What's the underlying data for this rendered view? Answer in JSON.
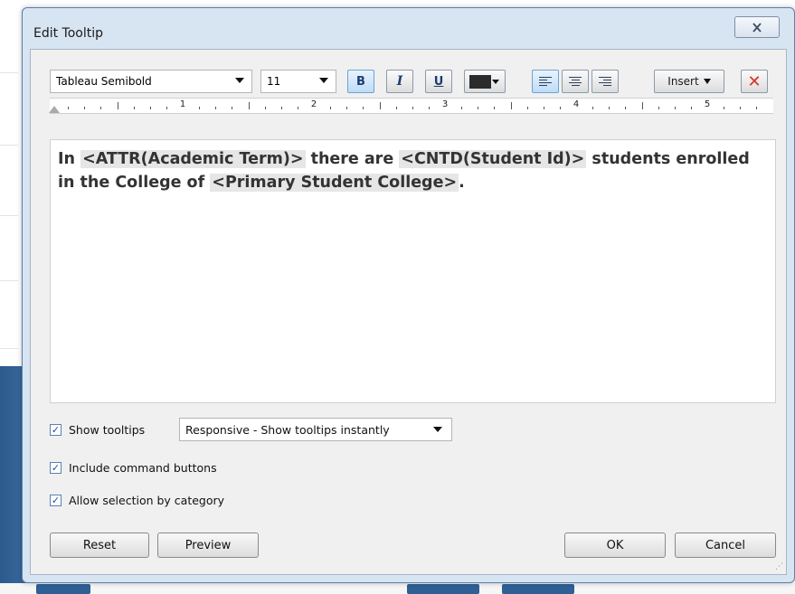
{
  "dialog": {
    "title": "Edit Tooltip",
    "close_icon": "close-icon"
  },
  "toolbar": {
    "font_family": "Tableau Semibold",
    "font_size": "11",
    "bold_label": "B",
    "italic_label": "I",
    "underline_label": "U",
    "text_color": "#2b2b2b",
    "insert_label": "Insert",
    "clear_label": "✕"
  },
  "ruler": {
    "labels": [
      "1",
      "2",
      "3",
      "4",
      "5"
    ]
  },
  "editor": {
    "t1": "In ",
    "f1": "<ATTR(Academic Term)>",
    "t2": " there are ",
    "f2": "<CNTD(Student Id)>",
    "t3": " students enrolled in the College of ",
    "f3": "<Primary Student College>",
    "t4": "."
  },
  "options": {
    "show_tooltips": {
      "label": "Show tooltips",
      "checked": true
    },
    "tooltip_mode": "Responsive - Show tooltips instantly",
    "include_command_buttons": {
      "label": "Include command buttons",
      "checked": true
    },
    "allow_selection": {
      "label": "Allow selection by category",
      "checked": true
    }
  },
  "buttons": {
    "reset": "Reset",
    "preview": "Preview",
    "ok": "OK",
    "cancel": "Cancel"
  },
  "colors": {
    "accent": "#6fa1d3",
    "clear": "#d6322a",
    "window_border": "#5c7fa8"
  }
}
